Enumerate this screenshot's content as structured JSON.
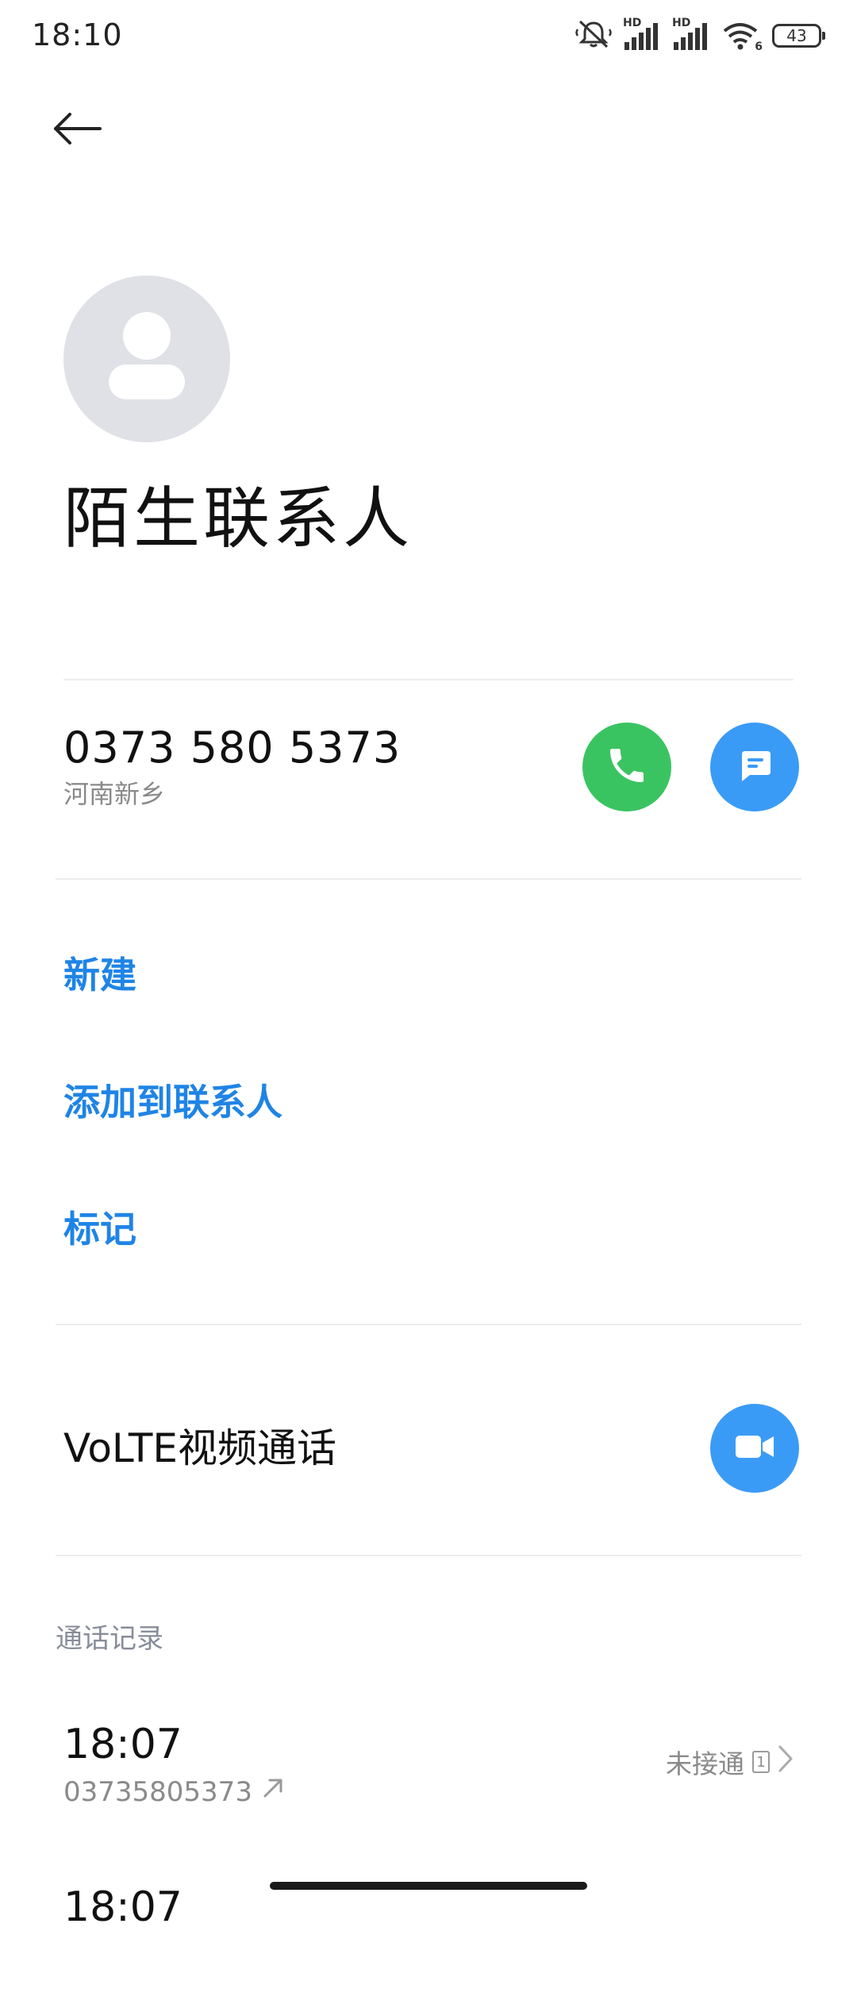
{
  "status_bar": {
    "time": "18:10",
    "signal_label_1": "HD",
    "signal_label_2": "HD",
    "wifi_label": "6",
    "battery": "43"
  },
  "contact": {
    "name": "陌生联系人",
    "phone_number": "0373 580 5373",
    "location": "河南新乡"
  },
  "actions": {
    "new": "新建",
    "add_to_contacts": "添加到联系人",
    "mark": "标记"
  },
  "volte": {
    "label": "VoLTE视频通话"
  },
  "call_log": {
    "header": "通话记录",
    "entries": [
      {
        "time": "18:07",
        "number": "03735805373",
        "status": "未接通",
        "count": "1"
      },
      {
        "time": "18:07"
      }
    ]
  },
  "colors": {
    "call_green": "#3ac461",
    "accent_blue": "#3a9bf7",
    "link_blue": "#1f84e6",
    "avatar_gray": "#dfe1e6"
  }
}
